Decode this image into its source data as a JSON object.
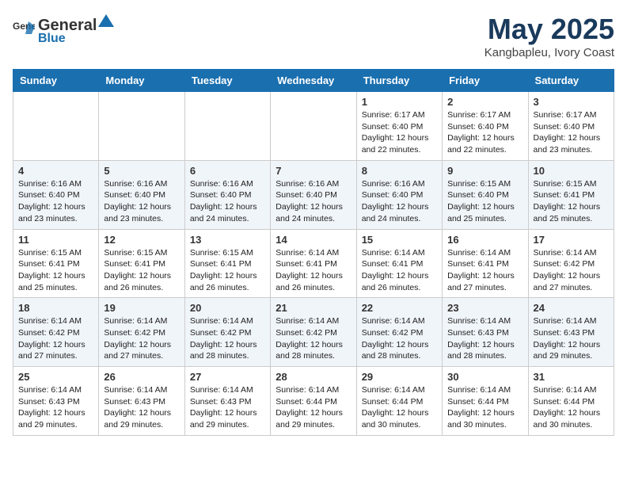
{
  "header": {
    "logo_general": "General",
    "logo_blue": "Blue",
    "title": "May 2025",
    "location": "Kangbapleu, Ivory Coast"
  },
  "weekdays": [
    "Sunday",
    "Monday",
    "Tuesday",
    "Wednesday",
    "Thursday",
    "Friday",
    "Saturday"
  ],
  "weeks": [
    [
      {
        "day": "",
        "info": ""
      },
      {
        "day": "",
        "info": ""
      },
      {
        "day": "",
        "info": ""
      },
      {
        "day": "",
        "info": ""
      },
      {
        "day": "1",
        "info": "Sunrise: 6:17 AM\nSunset: 6:40 PM\nDaylight: 12 hours\nand 22 minutes."
      },
      {
        "day": "2",
        "info": "Sunrise: 6:17 AM\nSunset: 6:40 PM\nDaylight: 12 hours\nand 22 minutes."
      },
      {
        "day": "3",
        "info": "Sunrise: 6:17 AM\nSunset: 6:40 PM\nDaylight: 12 hours\nand 23 minutes."
      }
    ],
    [
      {
        "day": "4",
        "info": "Sunrise: 6:16 AM\nSunset: 6:40 PM\nDaylight: 12 hours\nand 23 minutes."
      },
      {
        "day": "5",
        "info": "Sunrise: 6:16 AM\nSunset: 6:40 PM\nDaylight: 12 hours\nand 23 minutes."
      },
      {
        "day": "6",
        "info": "Sunrise: 6:16 AM\nSunset: 6:40 PM\nDaylight: 12 hours\nand 24 minutes."
      },
      {
        "day": "7",
        "info": "Sunrise: 6:16 AM\nSunset: 6:40 PM\nDaylight: 12 hours\nand 24 minutes."
      },
      {
        "day": "8",
        "info": "Sunrise: 6:16 AM\nSunset: 6:40 PM\nDaylight: 12 hours\nand 24 minutes."
      },
      {
        "day": "9",
        "info": "Sunrise: 6:15 AM\nSunset: 6:40 PM\nDaylight: 12 hours\nand 25 minutes."
      },
      {
        "day": "10",
        "info": "Sunrise: 6:15 AM\nSunset: 6:41 PM\nDaylight: 12 hours\nand 25 minutes."
      }
    ],
    [
      {
        "day": "11",
        "info": "Sunrise: 6:15 AM\nSunset: 6:41 PM\nDaylight: 12 hours\nand 25 minutes."
      },
      {
        "day": "12",
        "info": "Sunrise: 6:15 AM\nSunset: 6:41 PM\nDaylight: 12 hours\nand 26 minutes."
      },
      {
        "day": "13",
        "info": "Sunrise: 6:15 AM\nSunset: 6:41 PM\nDaylight: 12 hours\nand 26 minutes."
      },
      {
        "day": "14",
        "info": "Sunrise: 6:14 AM\nSunset: 6:41 PM\nDaylight: 12 hours\nand 26 minutes."
      },
      {
        "day": "15",
        "info": "Sunrise: 6:14 AM\nSunset: 6:41 PM\nDaylight: 12 hours\nand 26 minutes."
      },
      {
        "day": "16",
        "info": "Sunrise: 6:14 AM\nSunset: 6:41 PM\nDaylight: 12 hours\nand 27 minutes."
      },
      {
        "day": "17",
        "info": "Sunrise: 6:14 AM\nSunset: 6:42 PM\nDaylight: 12 hours\nand 27 minutes."
      }
    ],
    [
      {
        "day": "18",
        "info": "Sunrise: 6:14 AM\nSunset: 6:42 PM\nDaylight: 12 hours\nand 27 minutes."
      },
      {
        "day": "19",
        "info": "Sunrise: 6:14 AM\nSunset: 6:42 PM\nDaylight: 12 hours\nand 27 minutes."
      },
      {
        "day": "20",
        "info": "Sunrise: 6:14 AM\nSunset: 6:42 PM\nDaylight: 12 hours\nand 28 minutes."
      },
      {
        "day": "21",
        "info": "Sunrise: 6:14 AM\nSunset: 6:42 PM\nDaylight: 12 hours\nand 28 minutes."
      },
      {
        "day": "22",
        "info": "Sunrise: 6:14 AM\nSunset: 6:42 PM\nDaylight: 12 hours\nand 28 minutes."
      },
      {
        "day": "23",
        "info": "Sunrise: 6:14 AM\nSunset: 6:43 PM\nDaylight: 12 hours\nand 28 minutes."
      },
      {
        "day": "24",
        "info": "Sunrise: 6:14 AM\nSunset: 6:43 PM\nDaylight: 12 hours\nand 29 minutes."
      }
    ],
    [
      {
        "day": "25",
        "info": "Sunrise: 6:14 AM\nSunset: 6:43 PM\nDaylight: 12 hours\nand 29 minutes."
      },
      {
        "day": "26",
        "info": "Sunrise: 6:14 AM\nSunset: 6:43 PM\nDaylight: 12 hours\nand 29 minutes."
      },
      {
        "day": "27",
        "info": "Sunrise: 6:14 AM\nSunset: 6:43 PM\nDaylight: 12 hours\nand 29 minutes."
      },
      {
        "day": "28",
        "info": "Sunrise: 6:14 AM\nSunset: 6:44 PM\nDaylight: 12 hours\nand 29 minutes."
      },
      {
        "day": "29",
        "info": "Sunrise: 6:14 AM\nSunset: 6:44 PM\nDaylight: 12 hours\nand 30 minutes."
      },
      {
        "day": "30",
        "info": "Sunrise: 6:14 AM\nSunset: 6:44 PM\nDaylight: 12 hours\nand 30 minutes."
      },
      {
        "day": "31",
        "info": "Sunrise: 6:14 AM\nSunset: 6:44 PM\nDaylight: 12 hours\nand 30 minutes."
      }
    ]
  ]
}
